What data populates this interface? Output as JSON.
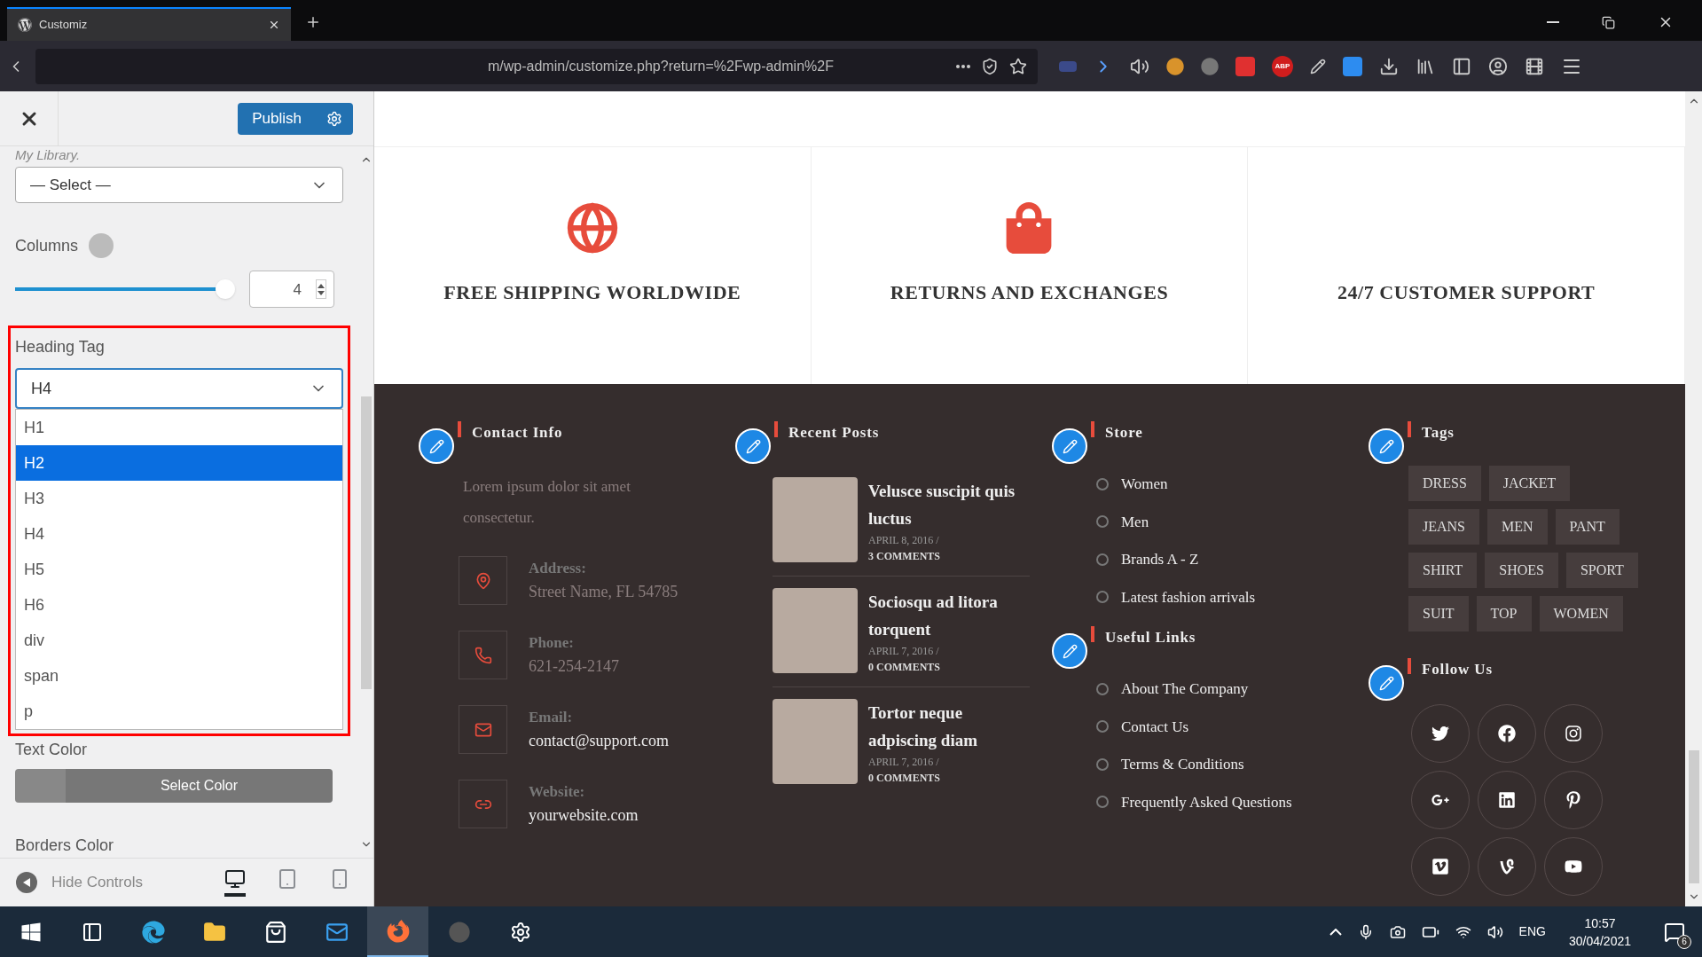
{
  "browser": {
    "tab_title": "Customiz",
    "address": "m/wp-admin/customize.php?return=%2Fwp-admin%2F",
    "extension_badge": "ABP"
  },
  "customizer": {
    "publish": "Publish",
    "section_label": "My Library.",
    "library_select": "— Select —",
    "columns_label": "Columns",
    "columns_slider": {
      "level": 1
    },
    "columns_value": "4",
    "heading_label": "Heading Tag",
    "heading_value": "H4",
    "heading_options": [
      {
        "label": "H1",
        "selected": false
      },
      {
        "label": "H2",
        "selected": true
      },
      {
        "label": "H3",
        "selected": false
      },
      {
        "label": "H4",
        "selected": false
      },
      {
        "label": "H5",
        "selected": false
      },
      {
        "label": "H6",
        "selected": false
      },
      {
        "label": "div",
        "selected": false
      },
      {
        "label": "span",
        "selected": false
      },
      {
        "label": "p",
        "selected": false
      }
    ],
    "text_color_label": "Text Color",
    "select_color": "Select Color",
    "borders_color_label": "Borders Color",
    "hide_controls": "Hide Controls",
    "devices": [
      {
        "kind": "desktop",
        "selected": true
      },
      {
        "kind": "tablet",
        "selected": false
      },
      {
        "kind": "mobile",
        "selected": false
      }
    ]
  },
  "features": [
    {
      "kind": "globe",
      "title": "FREE SHIPPING WORLDWIDE"
    },
    {
      "kind": "bag",
      "title": "RETURNS AND EXCHANGES"
    },
    {
      "kind": "none",
      "title": "24/7 CUSTOMER SUPPORT"
    }
  ],
  "footer": {
    "contact": {
      "title": "Contact Info",
      "intro": "Lorem ipsum dolor sit amet consectetur.",
      "items": [
        {
          "kind": "address",
          "label": "Address:",
          "value": "Street Name, FL 54785",
          "muted": true
        },
        {
          "kind": "phone",
          "label": "Phone:",
          "value": "621-254-2147",
          "muted": true
        },
        {
          "kind": "email",
          "label": "Email:",
          "value": "contact@support.com",
          "muted": false
        },
        {
          "kind": "website",
          "label": "Website:",
          "value": "yourwebsite.com",
          "muted": false
        }
      ]
    },
    "recent_posts": {
      "title": "Recent Posts",
      "posts": [
        {
          "title": "Velusce suscipit quis luctus",
          "date": "APRIL 8, 2016 /",
          "comments": "3 COMMENTS"
        },
        {
          "title": "Sociosqu ad litora torquent",
          "date": "APRIL 7, 2016 /",
          "comments": "0 COMMENTS"
        },
        {
          "title": "Tortor neque adpiscing diam",
          "date": "APRIL 7, 2016 /",
          "comments": "0 COMMENTS"
        }
      ]
    },
    "store": {
      "title": "Store",
      "links": [
        "Women",
        "Men",
        "Brands A - Z",
        "Latest fashion arrivals"
      ]
    },
    "useful_links": {
      "title": "Useful Links",
      "links": [
        "About The Company",
        "Contact Us",
        "Terms & Conditions",
        "Frequently Asked Questions"
      ]
    },
    "tags": {
      "title": "Tags",
      "rows": [
        [
          "DRESS",
          "JACKET"
        ],
        [
          "JEANS",
          "MEN",
          "PANT"
        ],
        [
          "SHIRT",
          "SHOES",
          "SPORT"
        ],
        [
          "SUIT",
          "TOP",
          "WOMEN"
        ]
      ]
    },
    "follow": {
      "title": "Follow Us",
      "networks": [
        {
          "kind": "twitter"
        },
        {
          "kind": "facebook"
        },
        {
          "kind": "instagram"
        },
        {
          "kind": "googleplus"
        },
        {
          "kind": "linkedin"
        },
        {
          "kind": "pinterest"
        },
        {
          "kind": "vimeo-square"
        },
        {
          "kind": "vine"
        },
        {
          "kind": "youtube"
        }
      ]
    }
  },
  "taskbar": {
    "apps": [
      {
        "kind": "windows",
        "selected": false
      },
      {
        "kind": "taskview",
        "selected": false
      },
      {
        "kind": "edge",
        "selected": false
      },
      {
        "kind": "explorer",
        "selected": false
      },
      {
        "kind": "store",
        "selected": false
      },
      {
        "kind": "mail",
        "selected": false
      },
      {
        "kind": "firefox",
        "selected": true
      },
      {
        "kind": "obs",
        "selected": false
      },
      {
        "kind": "settings",
        "selected": false
      }
    ],
    "language": "ENG",
    "time": "10:57",
    "date": "30/04/2021",
    "notifications": "6"
  }
}
